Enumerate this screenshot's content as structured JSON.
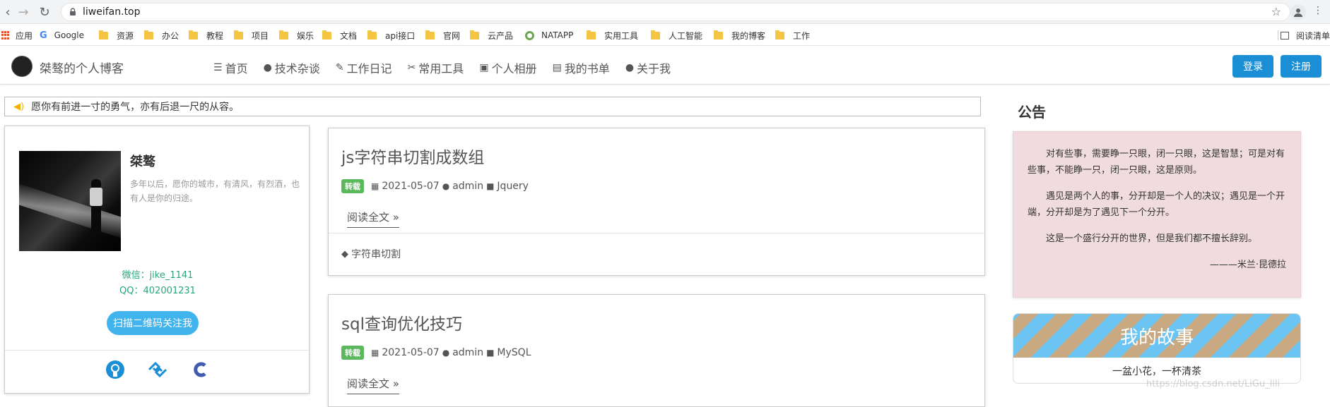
{
  "browser": {
    "url": "liweifan.top",
    "bookmarks": [
      "应用",
      "Google",
      "资源",
      "办公",
      "教程",
      "项目",
      "娱乐",
      "文档",
      "api接口",
      "官网",
      "云产品",
      "NATAPP",
      "实用工具",
      "人工智能",
      "我的博客",
      "工作"
    ],
    "reading_list": "阅读清单"
  },
  "site": {
    "title": "桀骜的个人博客",
    "menu": [
      "首页",
      "技术杂谈",
      "工作日记",
      "常用工具",
      "个人相册",
      "我的书单",
      "关于我"
    ],
    "login": "登录",
    "register": "注册"
  },
  "notice": "愿你有前进一寸的勇气，亦有后退一尺的从容。",
  "profile": {
    "name": "桀骜",
    "motto": "多年以后，愿你的城市，有清风，有烈酒，也有人是你的归途。",
    "wechat": "微信：jike_1141",
    "qq": "QQ：402001231",
    "qr_button": "扫描二维码关注我"
  },
  "articles": [
    {
      "title": "js字符串切割成数组",
      "badge": "转载",
      "date": "2021-05-07",
      "author": "admin",
      "category": "Jquery",
      "read_more": "阅读全文 »",
      "tag": "字符串切割"
    },
    {
      "title": "sql查询优化技巧",
      "badge": "转载",
      "date": "2021-05-07",
      "author": "admin",
      "category": "MySQL",
      "read_more": "阅读全文 »"
    }
  ],
  "announcement": {
    "title": "公告",
    "paragraphs": [
      "对有些事，需要睁一只眼，闭一只眼，这是智慧；可是对有些事，不能睁一只，闭一只眼，这是原则。",
      "遇见是两个人的事，分开却是一个人的决议；遇见是一个开端，分开却是为了遇见下一个分开。",
      "这是一个盛行分开的世界，但是我们都不擅长辞别。"
    ],
    "signature": "———米兰·昆德拉"
  },
  "story": {
    "title": "我的故事",
    "subtitle": "一盆小花，一杯清茶"
  },
  "watermark": "https://blog.csdn.net/LiGu_lili",
  "colors": {
    "primary": "#1a8fd6",
    "badge": "#5cb85c",
    "contact": "#27a67a",
    "announcement_bg": "#f0dcde"
  }
}
